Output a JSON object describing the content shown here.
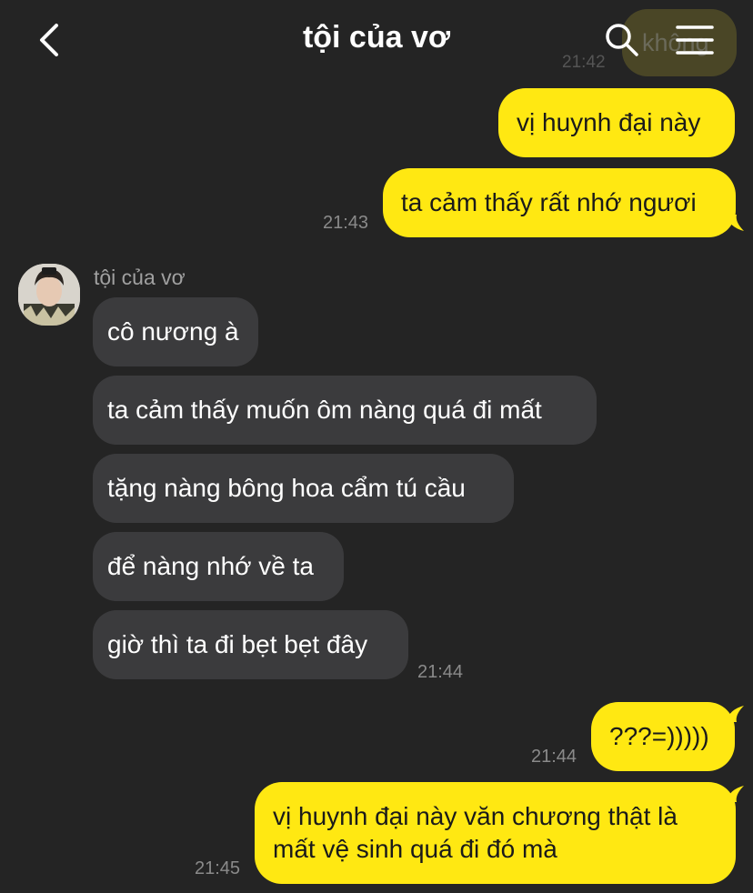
{
  "header": {
    "title": "tội của vơ",
    "back_icon": "chevron-left-icon",
    "search_icon": "search-icon",
    "menu_icon": "hamburger-menu-icon"
  },
  "ghost": {
    "text": "không",
    "time": "21:42"
  },
  "messages_out_1": {
    "m1": "vị huynh đại này",
    "m2": "ta cảm thấy rất nhớ ngươi",
    "time": "21:43"
  },
  "incoming": {
    "sender": "tội của vơ",
    "m1": "cô nương à",
    "m2": "ta cảm thấy muốn ôm nàng quá đi mất",
    "m3": "tặng nàng bông hoa cẩm tú cầu",
    "m4": "để nàng nhớ về ta",
    "m5": "giờ thì ta đi bẹt bẹt đây",
    "time": "21:44"
  },
  "messages_out_2": {
    "m1": "???=)))))",
    "time": "21:44"
  },
  "messages_out_3": {
    "m1_line1": "vị huynh đại này văn chương thật là",
    "m1_line2": "mất vệ sinh quá đi đó mà",
    "time": "21:45"
  },
  "colors": {
    "background": "#242424",
    "outgoing_bubble": "#ffe812",
    "incoming_bubble": "#3b3b3d"
  }
}
